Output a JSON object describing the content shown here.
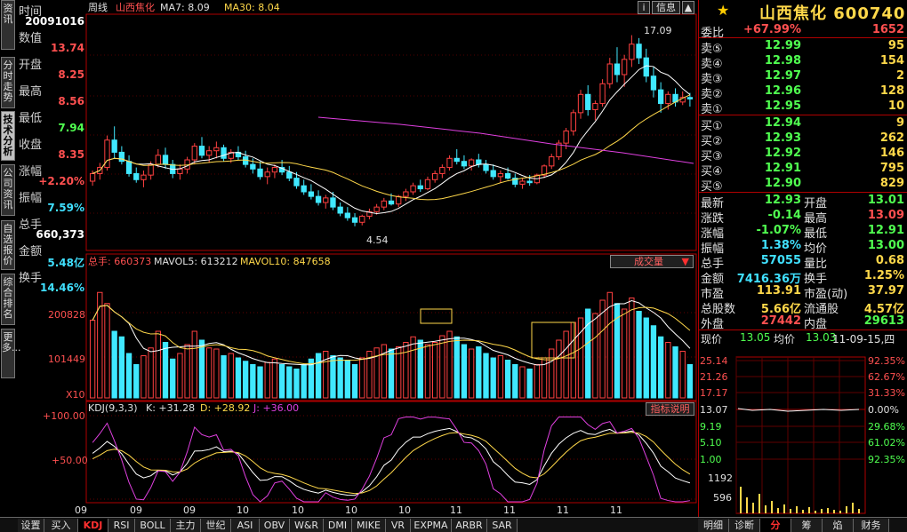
{
  "left_tabs": [
    {
      "label": "资讯",
      "active": false
    },
    {
      "label": "分时走势",
      "active": false
    },
    {
      "label": "技术分析",
      "active": true
    },
    {
      "label": "公司资讯",
      "active": false
    },
    {
      "label": "自选报价",
      "active": false
    },
    {
      "label": "综合排名",
      "active": false
    },
    {
      "label": "更多...",
      "active": false
    }
  ],
  "info": {
    "time_label": "时间",
    "time_value": "20091016",
    "open_label": "数值",
    "open_value": "13.74",
    "c1_label": "开盘",
    "c1_value": "8.25",
    "c2_label": "最高",
    "c2_value": "8.56",
    "c3_label": "最低",
    "c3_value": "7.94",
    "c4_label": "收盘",
    "c4_value": "8.35",
    "c5_label": "涨幅",
    "c5_value": "+2.20%",
    "c6_label": "振幅",
    "c6_value": "7.59%",
    "c7_label": "总手",
    "c7_value": "660,373",
    "c8_label": "金额",
    "c8_value": "5.48亿",
    "c9_label": "换手",
    "c9_value": "14.46%"
  },
  "header": {
    "period": "周线",
    "stock": "山西焦化",
    "ma7": "MA7: 8.09",
    "ma30": "MA30: 8.04",
    "btn_info": "信息",
    "btn_i": "i",
    "max_label": "17.09",
    "min_label": "4.54"
  },
  "volume_panel": {
    "label": "总手: 660373",
    "mavol5": "MAVOL5: 613212",
    "mavol10": "MAVOL10: 847658",
    "selector": "成交量",
    "tick_200": "200828",
    "tick_101": "101449",
    "tick_x10": "X10"
  },
  "kdj_panel": {
    "label": "KDJ(9,3,3)",
    "k": "K: +31.28",
    "d": "D: +28.92",
    "j": "J: +36.00",
    "help": "指标说明",
    "tick_100": "+100.00",
    "tick_50": "+50.00"
  },
  "x_axis": [
    "09",
    "09",
    "09",
    "10",
    "10",
    "10",
    "10",
    "11",
    "11",
    "11",
    "11"
  ],
  "bottom_tabs": [
    "设置",
    "买入",
    "KDJ",
    "RSI",
    "BOLL",
    "主力",
    "世纪",
    "ASI",
    "OBV",
    "W&R",
    "DMI",
    "MIKE",
    "VR",
    "EXPMA",
    "ARBR",
    "SAR"
  ],
  "bottom_tabs_active": "KDJ",
  "right_tabs": [
    "明细",
    "诊断",
    "分",
    "筹",
    "焰",
    "财务"
  ],
  "right_tabs_active": "分",
  "quote": {
    "star": "★",
    "name": "山西焦化 600740",
    "weibi_label": "委比",
    "weibi_pct": "+67.99%",
    "weibi_val": "1652",
    "asks": [
      {
        "label": "卖⑤",
        "price": "12.99",
        "vol": "95"
      },
      {
        "label": "卖④",
        "price": "12.98",
        "vol": "154"
      },
      {
        "label": "卖③",
        "price": "12.97",
        "vol": "2"
      },
      {
        "label": "卖②",
        "price": "12.96",
        "vol": "128"
      },
      {
        "label": "卖①",
        "price": "12.95",
        "vol": "10"
      }
    ],
    "bids": [
      {
        "label": "买①",
        "price": "12.94",
        "vol": "9"
      },
      {
        "label": "买②",
        "price": "12.93",
        "vol": "262"
      },
      {
        "label": "买③",
        "price": "12.92",
        "vol": "146"
      },
      {
        "label": "买④",
        "price": "12.91",
        "vol": "795"
      },
      {
        "label": "买⑤",
        "price": "12.90",
        "vol": "829"
      }
    ],
    "stats": [
      {
        "l1": "最新",
        "v1": "12.93",
        "l2": "开盘",
        "v2": "13.01",
        "c1": "#50ff50",
        "c2": "#50ff50"
      },
      {
        "l1": "涨跌",
        "v1": "-0.14",
        "l2": "最高",
        "v2": "13.09",
        "c1": "#50ff50",
        "c2": "#ff5050"
      },
      {
        "l1": "涨幅",
        "v1": "-1.07%",
        "l2": "最低",
        "v2": "12.91",
        "c1": "#50ff50",
        "c2": "#50ff50"
      },
      {
        "l1": "振幅",
        "v1": "1.38%",
        "l2": "均价",
        "v2": "13.00",
        "c1": "#40e0ff",
        "c2": "#50ff50"
      },
      {
        "l1": "总手",
        "v1": "57055",
        "l2": "量比",
        "v2": "0.68",
        "c1": "#40e0ff",
        "c2": "#ffd84a"
      },
      {
        "l1": "金额",
        "v1": "7416.36万",
        "l2": "换手",
        "v2": "1.25%",
        "c1": "#40e0ff",
        "c2": "#ffd84a"
      },
      {
        "l1": "市盈",
        "v1": "113.91",
        "l2": "市盈(动)",
        "v2": "37.97",
        "c1": "#ffd84a",
        "c2": "#ffd84a"
      },
      {
        "l1": "总股数",
        "v1": "5.66亿",
        "l2": "流通股",
        "v2": "4.57亿",
        "c1": "#ffd84a",
        "c2": "#ffd84a"
      },
      {
        "l1": "外盘",
        "v1": "27442",
        "l2": "内盘",
        "v2": "29613",
        "c1": "#ff5050",
        "c2": "#50ff50"
      }
    ],
    "now_label": "现价",
    "now_val": "13.05",
    "avg_label": "均价",
    "avg_val": "13.03",
    "date": "11-09-15,四"
  },
  "mini_chart": {
    "left_ticks": [
      "25.14",
      "21.26",
      "17.17",
      "13.07",
      "9.19",
      "5.10",
      "1.00"
    ],
    "right_ticks": [
      "92.35%",
      "62.67%",
      "31.33%",
      "0.00%",
      "29.68%",
      "61.02%",
      "92.35%"
    ],
    "vol_ticks": [
      "1192",
      "596"
    ]
  },
  "chart_data": {
    "type": "candlestick",
    "title": "山西焦化 周线",
    "price_ylim": [
      4.0,
      18.0
    ],
    "candles": [
      [
        7.5,
        8.2,
        7.2,
        8.0
      ],
      [
        8.0,
        8.7,
        7.6,
        8.4
      ],
      [
        8.4,
        10.5,
        8.2,
        10.2
      ],
      [
        10.2,
        11.1,
        9.0,
        9.4
      ],
      [
        9.4,
        9.8,
        8.6,
        8.8
      ],
      [
        8.8,
        9.2,
        7.8,
        8.0
      ],
      [
        8.0,
        8.4,
        7.4,
        7.6
      ],
      [
        7.6,
        8.2,
        7.1,
        7.9
      ],
      [
        7.9,
        8.8,
        7.6,
        8.6
      ],
      [
        8.6,
        9.6,
        8.4,
        9.2
      ],
      [
        9.2,
        9.7,
        8.3,
        8.6
      ],
      [
        8.6,
        8.9,
        7.7,
        8.0
      ],
      [
        8.0,
        8.6,
        7.6,
        8.3
      ],
      [
        8.3,
        9.1,
        8.0,
        8.9
      ],
      [
        8.9,
        10.0,
        8.6,
        9.8
      ],
      [
        9.8,
        10.4,
        9.0,
        9.2
      ],
      [
        9.2,
        9.8,
        8.7,
        9.5
      ],
      [
        9.5,
        10.1,
        9.0,
        9.7
      ],
      [
        9.7,
        9.9,
        8.8,
        9.0
      ],
      [
        9.0,
        9.6,
        8.7,
        9.4
      ],
      [
        9.4,
        9.8,
        8.9,
        9.1
      ],
      [
        9.1,
        9.5,
        8.4,
        8.6
      ],
      [
        8.6,
        9.0,
        8.0,
        8.3
      ],
      [
        8.3,
        8.8,
        7.6,
        7.8
      ],
      [
        7.8,
        8.4,
        7.3,
        8.1
      ],
      [
        8.1,
        8.6,
        7.7,
        8.4
      ],
      [
        8.4,
        8.9,
        7.9,
        8.1
      ],
      [
        8.1,
        8.5,
        7.5,
        7.7
      ],
      [
        7.7,
        8.1,
        7.0,
        7.2
      ],
      [
        7.2,
        7.6,
        6.6,
        6.8
      ],
      [
        6.8,
        7.3,
        6.3,
        6.5
      ],
      [
        6.5,
        6.9,
        5.9,
        6.1
      ],
      [
        6.1,
        6.6,
        5.7,
        6.4
      ],
      [
        6.4,
        6.8,
        5.6,
        5.8
      ],
      [
        5.8,
        6.1,
        5.2,
        5.4
      ],
      [
        5.4,
        5.8,
        4.9,
        5.1
      ],
      [
        5.1,
        5.4,
        4.54,
        4.8
      ],
      [
        4.8,
        5.3,
        4.6,
        5.2
      ],
      [
        5.2,
        5.7,
        5.0,
        5.5
      ],
      [
        5.5,
        6.0,
        5.3,
        5.8
      ],
      [
        5.8,
        6.4,
        5.6,
        6.2
      ],
      [
        6.2,
        6.7,
        5.9,
        6.0
      ],
      [
        6.0,
        6.6,
        5.8,
        6.5
      ],
      [
        6.5,
        7.0,
        6.2,
        6.8
      ],
      [
        6.8,
        7.4,
        6.6,
        7.2
      ],
      [
        7.2,
        7.6,
        6.8,
        7.0
      ],
      [
        7.0,
        7.8,
        6.9,
        7.6
      ],
      [
        7.6,
        8.2,
        7.4,
        8.0
      ],
      [
        8.0,
        8.6,
        7.7,
        8.4
      ],
      [
        8.4,
        9.2,
        8.2,
        9.0
      ],
      [
        9.0,
        9.6,
        8.6,
        8.8
      ],
      [
        8.8,
        9.2,
        8.3,
        8.5
      ],
      [
        8.5,
        9.0,
        8.2,
        8.9
      ],
      [
        8.9,
        9.3,
        8.4,
        8.6
      ],
      [
        8.6,
        8.9,
        8.0,
        8.2
      ],
      [
        8.2,
        8.6,
        7.6,
        7.8
      ],
      [
        7.8,
        8.2,
        7.4,
        8.0
      ],
      [
        8.0,
        8.4,
        7.6,
        7.7
      ],
      [
        7.7,
        8.0,
        7.1,
        7.3
      ],
      [
        7.3,
        7.7,
        7.0,
        7.5
      ],
      [
        7.5,
        7.9,
        7.2,
        7.4
      ],
      [
        7.4,
        8.0,
        7.3,
        7.9
      ],
      [
        7.9,
        8.6,
        7.7,
        8.5
      ],
      [
        8.5,
        9.3,
        8.3,
        9.1
      ],
      [
        9.1,
        10.2,
        8.9,
        10.0
      ],
      [
        10.0,
        11.0,
        9.6,
        10.8
      ],
      [
        10.8,
        12.2,
        10.5,
        12.0
      ],
      [
        12.0,
        13.5,
        11.6,
        13.2
      ],
      [
        13.2,
        13.8,
        11.8,
        12.2
      ],
      [
        12.2,
        12.8,
        11.5,
        12.6
      ],
      [
        12.6,
        14.2,
        12.4,
        13.9
      ],
      [
        13.9,
        15.6,
        13.6,
        15.2
      ],
      [
        15.2,
        16.3,
        14.0,
        14.5
      ],
      [
        14.5,
        15.8,
        13.7,
        15.5
      ],
      [
        15.5,
        17.09,
        15.0,
        16.5
      ],
      [
        16.5,
        16.9,
        15.2,
        15.6
      ],
      [
        15.6,
        16.2,
        14.0,
        14.4
      ],
      [
        14.4,
        15.0,
        13.0,
        13.5
      ],
      [
        13.5,
        14.0,
        12.0,
        12.6
      ],
      [
        12.6,
        13.4,
        12.2,
        13.2
      ],
      [
        13.2,
        13.6,
        12.4,
        12.7
      ],
      [
        12.7,
        13.4,
        12.5,
        13.0
      ],
      [
        13.0,
        13.3,
        12.4,
        12.9
      ]
    ],
    "volume": [
      70,
      95,
      85,
      60,
      55,
      40,
      30,
      38,
      45,
      60,
      50,
      35,
      40,
      48,
      60,
      52,
      45,
      44,
      38,
      40,
      36,
      33,
      30,
      28,
      32,
      35,
      30,
      28,
      26,
      30,
      35,
      40,
      42,
      38,
      36,
      34,
      30,
      36,
      42,
      45,
      48,
      44,
      46,
      50,
      55,
      52,
      48,
      50,
      56,
      60,
      55,
      48,
      44,
      46,
      40,
      36,
      38,
      34,
      30,
      28,
      26,
      30,
      36,
      44,
      52,
      60,
      68,
      72,
      80,
      76,
      88,
      95,
      85,
      80,
      90,
      78,
      72,
      65,
      55,
      50,
      46,
      42,
      30
    ],
    "volume_ylim": [
      0,
      120
    ],
    "kdj_ylim": [
      0,
      110
    ]
  }
}
